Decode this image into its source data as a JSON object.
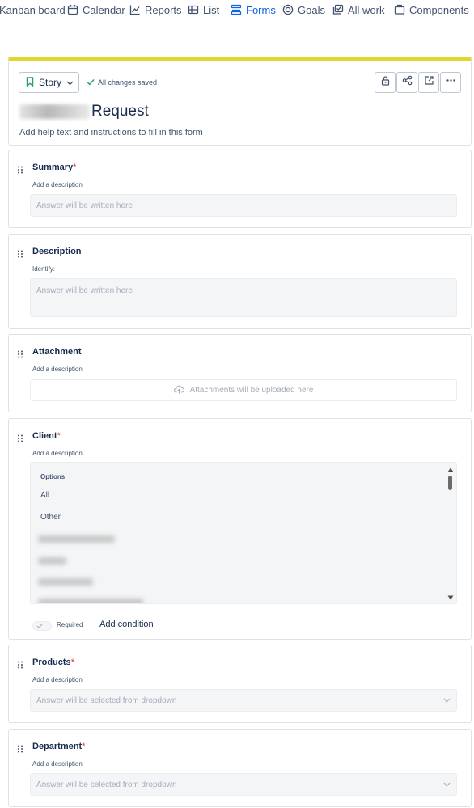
{
  "nav": {
    "tabs": [
      {
        "label": "Kanban board",
        "icon": "kanban-icon"
      },
      {
        "label": "Calendar",
        "icon": "calendar-icon"
      },
      {
        "label": "Reports",
        "icon": "reports-icon"
      },
      {
        "label": "List",
        "icon": "list-icon"
      },
      {
        "label": "Forms",
        "icon": "forms-icon",
        "active": true
      },
      {
        "label": "Goals",
        "icon": "goals-icon"
      },
      {
        "label": "All work",
        "icon": "all-work-icon"
      },
      {
        "label": "Components",
        "icon": "components-icon"
      }
    ]
  },
  "header": {
    "accent_color": "#e2d633",
    "issue_type": "Story",
    "saved_status": "All changes saved",
    "title_suffix": "Request",
    "help_text": "Add help text and instructions to fill in this form",
    "buttons": [
      "lock-icon",
      "share-icon",
      "open-external-icon",
      "more-icon"
    ]
  },
  "questions": {
    "summary": {
      "label": "Summary",
      "required_mark": "*",
      "description": "Add a description",
      "placeholder": "Answer will be written here"
    },
    "description": {
      "label": "Description",
      "description": "Identify:",
      "placeholder": "Answer will be written here"
    },
    "attachment": {
      "label": "Attachment",
      "description": "Add a description",
      "placeholder": "Attachments will be uploaded here"
    },
    "client": {
      "label": "Client",
      "required_mark": "*",
      "description": "Add a description",
      "options_title": "Options",
      "options": [
        "All",
        "Other"
      ],
      "required_label": "Required",
      "add_condition": "Add condition"
    },
    "products": {
      "label": "Products",
      "required_mark": "*",
      "description": "Add a description",
      "placeholder": "Answer will be selected from dropdown"
    },
    "department": {
      "label": "Department",
      "required_mark": "*",
      "description": "Add a description",
      "placeholder": "Answer will be selected from dropdown"
    }
  }
}
